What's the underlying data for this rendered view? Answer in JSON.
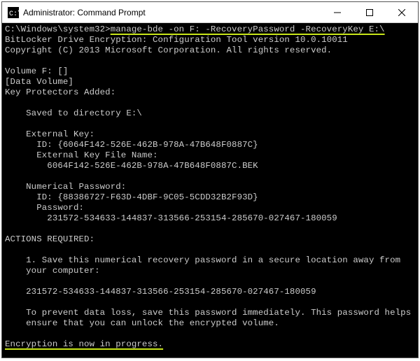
{
  "title": "Administrator: Command Prompt",
  "prompt_path": "C:\\Windows\\system32>",
  "command": "manage-bde -on F: -RecoveryPassword -RecoveryKey E:\\",
  "lines": {
    "l1": "BitLocker Drive Encryption: Configuration Tool version 10.0.10011",
    "l2": "Copyright (C) 2013 Microsoft Corporation. All rights reserved.",
    "l3": "Volume F: []",
    "l4": "[Data Volume]",
    "l5": "Key Protectors Added:",
    "l6": "    Saved to directory E:\\",
    "l7": "    External Key:",
    "l8": "      ID: {6064F142-526E-462B-978A-47B648F0887C}",
    "l9": "      External Key File Name:",
    "l10": "        6064F142-526E-462B-978A-47B648F0887C.BEK",
    "l11": "    Numerical Password:",
    "l12": "      ID: {88386727-F63D-4DBF-9C05-5CDD32B2F93D}",
    "l13": "      Password:",
    "l14": "        231572-534633-144837-313566-253154-285670-027467-180059",
    "l15": "ACTIONS REQUIRED:",
    "l16": "    1. Save this numerical recovery password in a secure location away from",
    "l17": "    your computer:",
    "l18": "    231572-534633-144837-313566-253154-285670-027467-180059",
    "l19": "    To prevent data loss, save this password immediately. This password helps",
    "l20": "    ensure that you can unlock the encrypted volume.",
    "status": "Encryption is now in progress."
  }
}
